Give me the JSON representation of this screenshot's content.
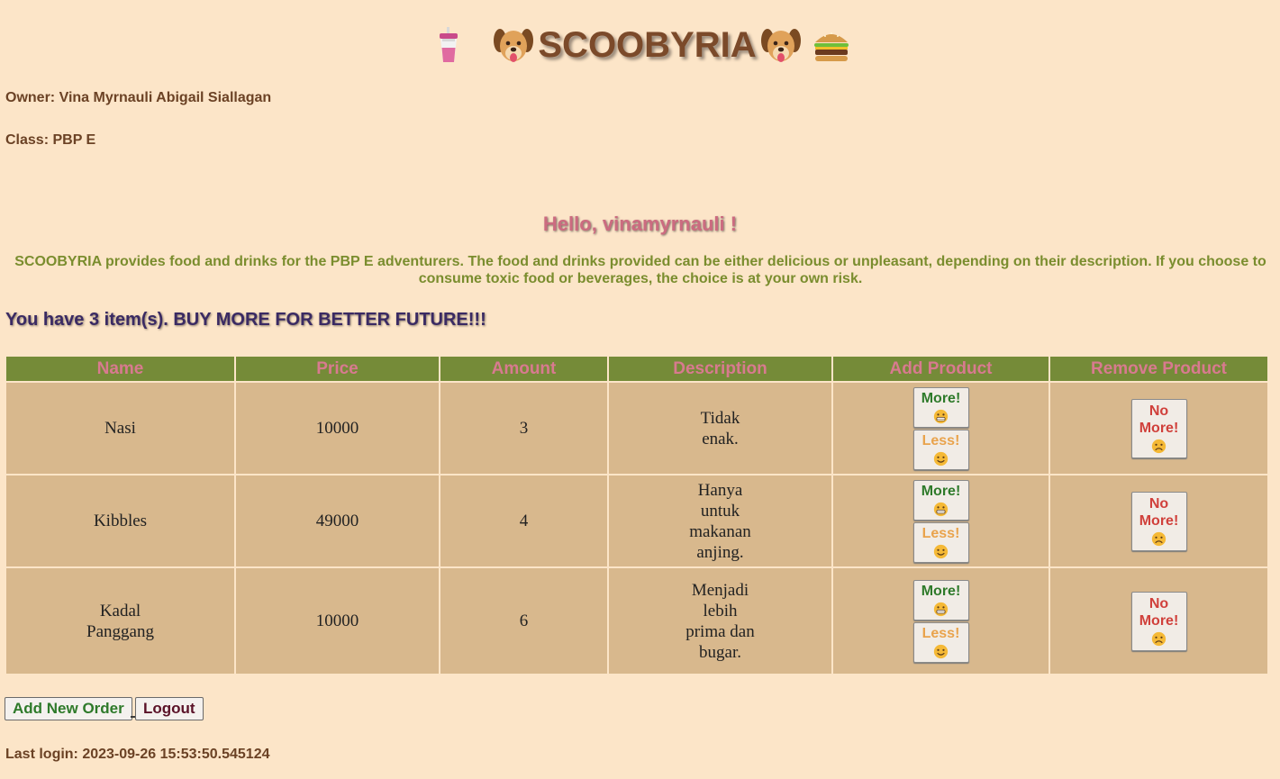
{
  "header": {
    "title": "SCOOBYRIA",
    "icons": [
      "drink-cup-icon",
      "dog-face-icon",
      "dog-face-icon",
      "burger-icon"
    ]
  },
  "info": {
    "owner": "Owner: Vina Myrnauli Abigail Siallagan",
    "class": "Class: PBP E"
  },
  "greeting": "Hello, vinamyrnauli !",
  "description": "SCOOBYRIA provides food and drinks for the PBP E adventurers. The food and drinks provided can be either delicious or unpleasant, depending on their description. If you choose to consume toxic food or beverages, the choice is at your own risk.",
  "items_message": "You have 3 item(s). BUY MORE FOR BETTER FUTURE!!!",
  "table": {
    "headers": {
      "name": "Name",
      "price": "Price",
      "amount": "Amount",
      "description": "Description",
      "add": "Add Product",
      "remove": "Remove Product"
    },
    "rows": [
      {
        "name": "Nasi",
        "price": "10000",
        "amount": "3",
        "description": "Tidak enak."
      },
      {
        "name": "Kibbles",
        "price": "49000",
        "amount": "4",
        "description": "Hanya untuk makanan anjing."
      },
      {
        "name": "Kadal Panggang",
        "price": "10000",
        "amount": "6",
        "description": "Menjadi lebih prima dan bugar."
      }
    ]
  },
  "buttons": {
    "more": "More!",
    "less": "Less!",
    "remove": "No More!",
    "add_order": "Add New Order",
    "logout": "Logout"
  },
  "last_login": "Last login: 2023-09-26 15:53:50.545124",
  "colors": {
    "background": "#fce5c8",
    "table_header": "#758b38",
    "table_cell": "#d8b88d",
    "more_text": "#2e7a2a",
    "less_text": "#e9a34c",
    "remove_text": "#d0403b"
  }
}
